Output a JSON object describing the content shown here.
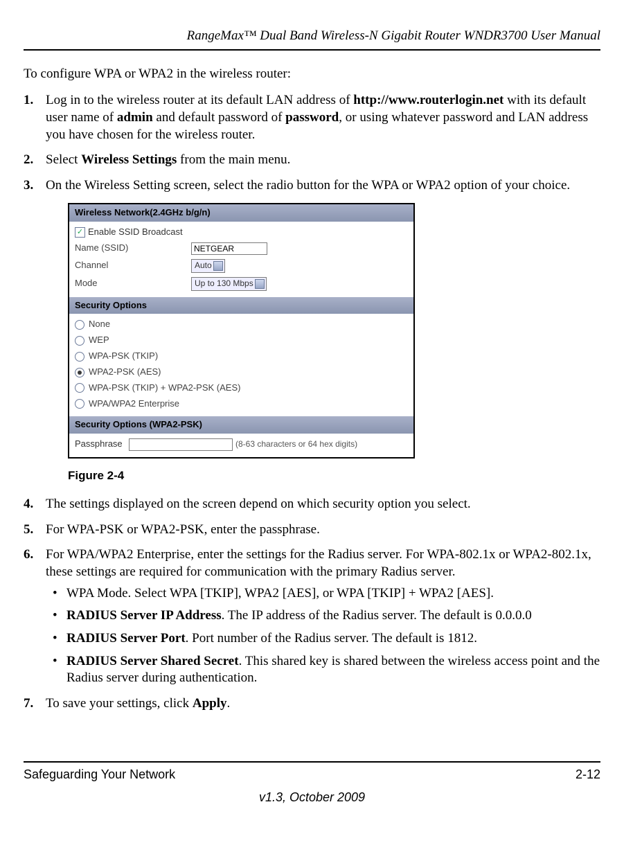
{
  "header": {
    "title": "RangeMax™ Dual Band Wireless-N Gigabit Router WNDR3700 User Manual"
  },
  "intro": "To configure WPA or WPA2 in the wireless router:",
  "steps": {
    "s1": {
      "num": "1.",
      "t1": "Log in to the wireless router at its default LAN address of ",
      "b1": "http://www.routerlogin.net",
      "t2": " with its default user name of ",
      "b2": "admin",
      "t3": " and default password of ",
      "b3": "password",
      "t4": ", or using whatever password and LAN address you have chosen for the wireless router."
    },
    "s2": {
      "num": "2.",
      "t1": "Select ",
      "b1": "Wireless Settings",
      "t2": " from the main menu."
    },
    "s3": {
      "num": "3.",
      "t1": "On the Wireless Setting screen, select the radio button for the WPA or WPA2 option of your choice."
    },
    "s4": {
      "num": "4.",
      "t1": "The settings displayed on the screen depend on which security option you select."
    },
    "s5": {
      "num": "5.",
      "t1": "For WPA-PSK or WPA2-PSK, enter the passphrase."
    },
    "s6": {
      "num": "6.",
      "t1": "For WPA/WPA2 Enterprise, enter the settings for the Radius server. For WPA-802.1x or WPA2-802.1x, these settings are required for communication with the primary Radius server.",
      "bullets": {
        "b1": "WPA Mode. Select WPA [TKIP], WPA2 [AES], or WPA [TKIP] + WPA2 [AES].",
        "b2_b": "RADIUS Server IP Address",
        "b2_t": ". The IP address of the Radius server. The default is 0.0.0.0",
        "b3_b": "RADIUS Server Port",
        "b3_t": ". Port number of the Radius server. The default is 1812.",
        "b4_b": "RADIUS Server Shared Secret",
        "b4_t": ". This shared key is shared between the wireless access point and the Radius server during authentication."
      }
    },
    "s7": {
      "num": "7.",
      "t1": "To save your settings, click ",
      "b1": "Apply",
      "t2": "."
    }
  },
  "figure": {
    "caption": "Figure 2-4",
    "section1_title": "Wireless Network(2.4GHz b/g/n)",
    "enable_ssid": "Enable SSID Broadcast",
    "name_label": "Name (SSID)",
    "name_value": "NETGEAR",
    "channel_label": "Channel",
    "channel_value": "Auto",
    "mode_label": "Mode",
    "mode_value": "Up to 130 Mbps",
    "section2_title": "Security Options",
    "opts": {
      "none": "None",
      "wep": "WEP",
      "wpa_tkip": "WPA-PSK (TKIP)",
      "wpa2_aes": "WPA2-PSK (AES)",
      "combo": "WPA-PSK (TKIP) + WPA2-PSK (AES)",
      "enterprise": "WPA/WPA2 Enterprise"
    },
    "section3_title": "Security Options (WPA2-PSK)",
    "passphrase_label": "Passphrase",
    "passphrase_hint": "(8-63 characters or 64 hex digits)"
  },
  "footer": {
    "left": "Safeguarding Your Network",
    "right": "2-12",
    "version": "v1.3, October 2009"
  }
}
